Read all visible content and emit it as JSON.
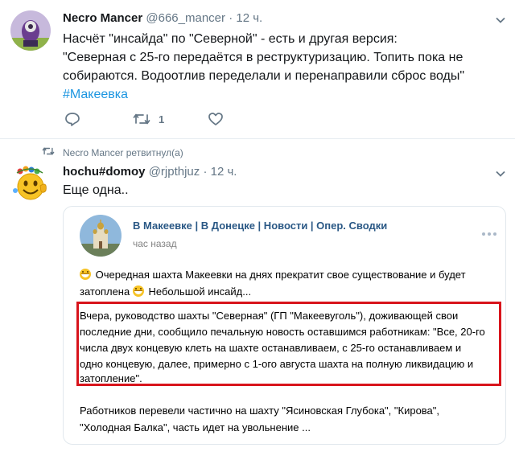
{
  "tweet1": {
    "name": "Necro Mancer",
    "handle": "@666_mancer",
    "dot": "·",
    "time": "12 ч.",
    "lines": [
      "Насчёт \"инсайда\" по \"Северной\" - есть и другая версия:",
      "\"Северная с 25-го передаётся в реструктуризацию. Топить пока не",
      "собираются. Водоотлив переделали и перенаправили сброс воды\""
    ],
    "hashtag": "#Макеевка",
    "retweet_count": "1"
  },
  "retweet_banner": "Necro Mancer ретвитнул(а)",
  "tweet2": {
    "name": "hochu#domoy",
    "handle": "@rjpthjuz",
    "dot": "·",
    "time": "12 ч.",
    "text": "Еще одна.."
  },
  "vk_card": {
    "group": "В Макеевке | В Донецке | Новости | Опер. Сводки",
    "time": "час назад",
    "intro_line1": "Очередная шахта Макеевки на днях прекратит свое существование и будет",
    "intro_line2_a": "затоплена",
    "intro_line2_b": "Небольшой инсайд...",
    "quote_lines": [
      "Вчера, руководство шахты \"Северная\" (ГП \"Макеевуголь\"), доживающей свои",
      "последние дни, сообщило печальную новость оставшимся работникам: \"Все, 20-го",
      "числа двух концевую клеть на шахте останавливаем, с 25-го останавливаем и",
      "одно концевую, далее, примерно с 1-ого августа шахта на полную ликвидацию и",
      "затопление\"."
    ],
    "outro_lines": [
      "Работников перевели частично на шахту \"Ясиновская Глубока\", \"Кирова\",",
      "\"Холодная Балка\", часть идет на увольнение ..."
    ]
  },
  "icons": {
    "reply": "reply-icon",
    "retweet": "retweet-icon",
    "like": "heart-icon",
    "caret": "chevron-down-icon",
    "more": "more-dots-icon"
  },
  "colors": {
    "link": "#1b95e0",
    "muted": "#657786",
    "vk_link": "#2a5885",
    "highlight": "#d8141c"
  }
}
